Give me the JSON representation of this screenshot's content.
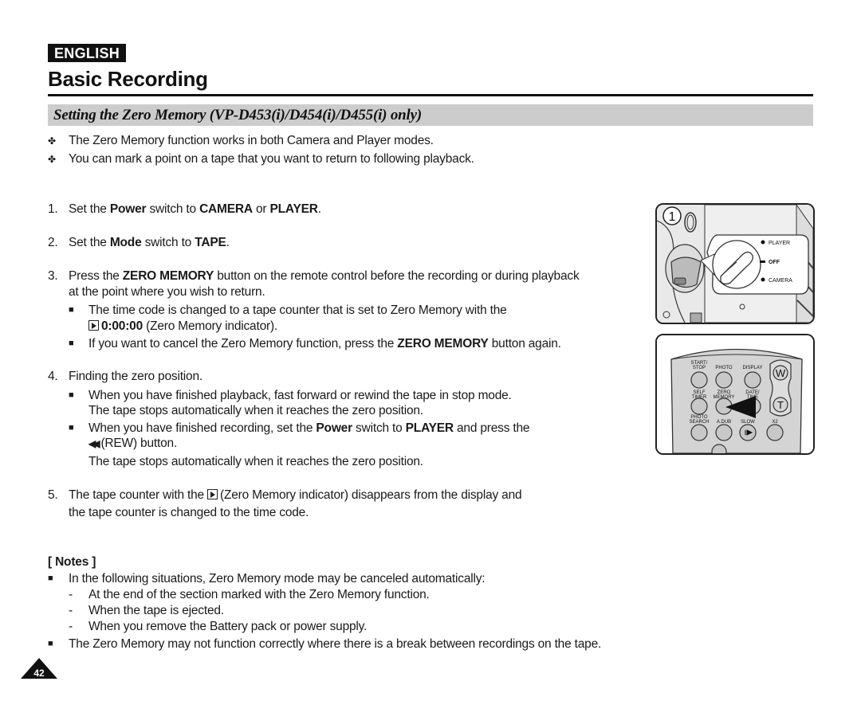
{
  "header": {
    "language_badge": "ENGLISH",
    "page_title": "Basic Recording",
    "section_title": "Setting the Zero Memory (VP-D453(i)/D454(i)/D455(i) only)"
  },
  "intro": [
    "The Zero Memory function works in both Camera and Player modes.",
    "You can mark a point on a tape that you want to return to following playback."
  ],
  "steps": {
    "s1": {
      "num": "1.",
      "pre": "Set the ",
      "b1": "Power",
      "mid": " switch to ",
      "b2": "CAMERA",
      "mid2": " or ",
      "b3": "PLAYER",
      "post": "."
    },
    "s2": {
      "num": "2.",
      "pre": "Set the ",
      "b1": "Mode",
      "mid": " switch to ",
      "b2": "TAPE",
      "post": "."
    },
    "s3": {
      "num": "3.",
      "pre": "Press the ",
      "b1": "ZERO MEMORY",
      "post": " button on the remote control before the recording or during playback",
      "cont": "at the point where you wish to return.",
      "sub1_line1": "The time code is changed to a tape counter that is set to Zero Memory with the",
      "sub1_counter": "0:00:00",
      "sub1_line2_post": " (Zero Memory indicator).",
      "sub2_pre": "If you want to cancel the Zero Memory function, press the ",
      "sub2_b": "ZERO MEMORY",
      "sub2_post": " button again."
    },
    "s4": {
      "num": "4.",
      "text": "Finding the zero position.",
      "sub1_line1": "When you have finished playback, fast forward or rewind the tape in stop mode.",
      "sub1_line2": "The tape stops automatically when it reaches the zero position.",
      "sub2_pre": "When you have finished recording, set the ",
      "sub2_b1": "Power",
      "sub2_mid": " switch to ",
      "sub2_b2": "PLAYER",
      "sub2_post": " and press the",
      "sub2_line2": "(REW) button.",
      "sub2_line3": "The tape stops automatically when it reaches the zero position."
    },
    "s5": {
      "num": "5.",
      "pre": "The tape counter with the ",
      "post": "(Zero Memory indicator) disappears from the display and",
      "cont": "the tape counter is changed to the time code."
    }
  },
  "notes": {
    "heading": "[ Notes ]",
    "item1": "In the following situations, Zero Memory mode may be canceled automatically:",
    "dashes": [
      "At the end of the section marked with the Zero Memory function.",
      "When the tape is ejected.",
      "When you remove the Battery pack or power supply."
    ],
    "item2": "The Zero Memory may not function correctly where there is a break between recordings on the tape."
  },
  "figure1": {
    "step_label": "1",
    "switch_labels": [
      "PLAYER",
      "OFF",
      "CAMERA"
    ]
  },
  "figure2": {
    "buttons": [
      "START/ STOP",
      "PHOTO",
      "DISPLAY",
      "SELF TIMER",
      "ZERO MEMORY",
      "DATE/ TIME",
      "PHOTO SEARCH",
      "A.DUB",
      "SLOW",
      "X2"
    ],
    "zoom_w": "W",
    "zoom_t": "T"
  },
  "page_number": "42",
  "symbols": {
    "intro_bullet": "✤",
    "square": "■",
    "dash": "-"
  }
}
